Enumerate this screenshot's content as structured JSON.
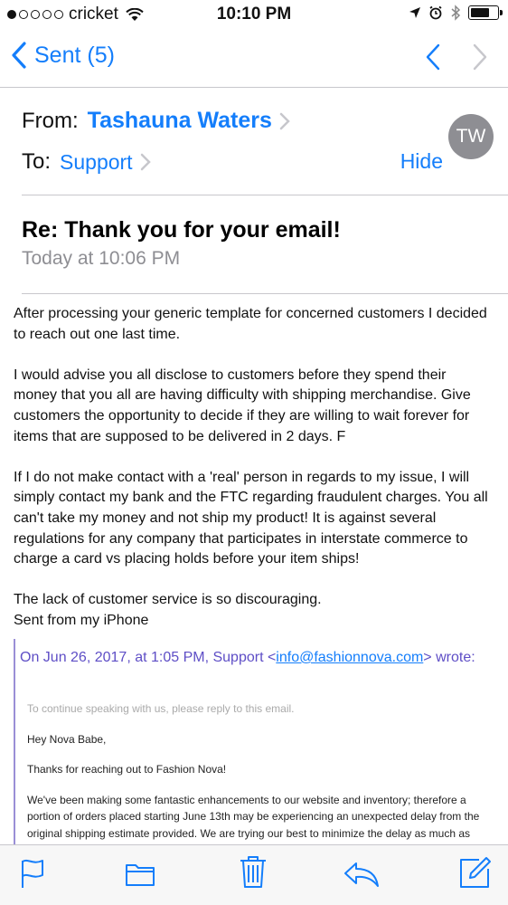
{
  "status_bar": {
    "carrier": "cricket",
    "time": "10:10 PM",
    "battery_level": 0.75
  },
  "nav": {
    "back_label": "Sent (5)",
    "up_icon": "chevron-up-icon",
    "down_icon": "chevron-down-icon"
  },
  "header": {
    "from_label": "From:",
    "from_name": "Tashauna Waters",
    "to_label": "To:",
    "to_name": "Support",
    "hide_label": "Hide",
    "avatar_initials": "TW"
  },
  "message": {
    "subject": "Re: Thank you for your email!",
    "date": "Today at 10:06 PM",
    "paragraphs": [
      "After processing your generic template for concerned customers I decided to reach out one last time.",
      "I would advise you all disclose to customers before they spend their money that you all are having difficulty with shipping merchandise.  Give customers the opportunity to decide if they are willing to wait forever for items that are supposed to be delivered in 2 days.  F",
      "If I do not make contact with a 'real' person in regards to my issue, I will simply contact my bank and the FTC regarding fraudulent charges. You all can't take my money and not ship my product! It is against several regulations for any company that participates in interstate commerce to charge a card vs placing holds before your item ships!",
      "The lack of customer service is so discouraging.",
      "Sent from my iPhone"
    ]
  },
  "quoted": {
    "header_prefix": "On Jun 26, 2017, at 1:05 PM, Support <",
    "email": "info@fashionnova.com",
    "header_suffix": "> wrote:",
    "notice": "To continue speaking with us, please reply to this email.",
    "greeting": "Hey Nova Babe,",
    "thanks": "Thanks for reaching out to Fashion Nova!",
    "body": "We've been making some fantastic enhancements to our website and inventory; therefore a portion of orders placed starting June 13th may be experiencing an unexpected delay from the original shipping estimate provided. We are trying our best to minimize the delay as much as possible to reduce any inconvenience to you. You will"
  },
  "toolbar": {
    "flag": "flag-icon",
    "folder": "folder-icon",
    "trash": "trash-icon",
    "reply": "reply-icon",
    "compose": "compose-icon"
  },
  "colors": {
    "accent": "#147efb",
    "quote_bar": "#9a8fd6",
    "quote_header": "#5e4ec6",
    "muted": "#8e8e93"
  }
}
